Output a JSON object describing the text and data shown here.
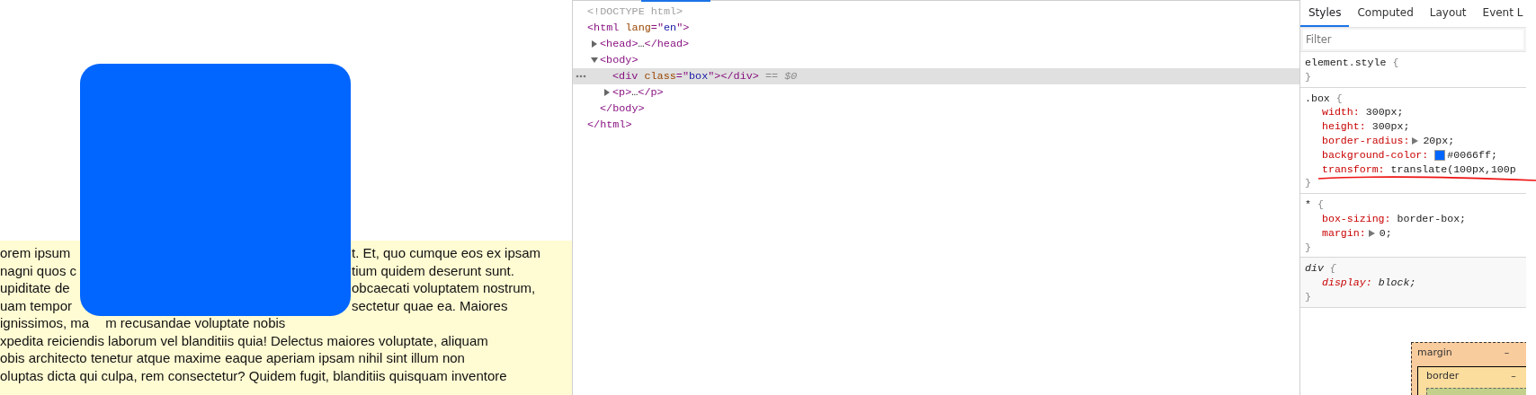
{
  "page": {
    "paragraph_lines": [
      {
        "left": "orem ipsum",
        "right": "t. Et, quo cumque eos ex ipsam"
      },
      {
        "left": "nagni quos c",
        "right": "tium quidem deserunt sunt."
      },
      {
        "left": "upiditate de",
        "right": "obcaecati voluptatem nostrum,"
      },
      {
        "left": "uam tempor",
        "right": "sectetur quae ea. Maiores"
      },
      {
        "left": "ignissimos, ma",
        "right": "m recusandae voluptate nobis"
      },
      {
        "text": "xpedita reiciendis laborum vel blanditiis quia! Delectus maiores voluptate, aliquam"
      },
      {
        "text": "obis architecto tenetur atque maxime eaque aperiam ipsam nihil sint illum non"
      },
      {
        "text": "oluptas dicta qui culpa, rem consectetur? Quidem fugit, blanditiis quisquam inventore"
      }
    ]
  },
  "elements": {
    "nodes": [
      {
        "selected": false,
        "tokens": [
          {
            "kind": "doctype",
            "text": "<!DOCTYPE html>"
          }
        ]
      },
      {
        "selected": false,
        "tokens": [
          {
            "kind": "tag",
            "text": "<html"
          },
          {
            "kind": "attr",
            "text": " lang"
          },
          {
            "kind": "tag",
            "text": "=\""
          },
          {
            "kind": "value",
            "text": "en"
          },
          {
            "kind": "tag",
            "text": "\">"
          }
        ],
        "children": [
          {
            "selected": false,
            "expanded": false,
            "tokens": [
              {
                "kind": "tag",
                "text": "<head>"
              },
              {
                "kind": "plain",
                "text": "…"
              },
              {
                "kind": "tag",
                "text": "</head>"
              }
            ]
          },
          {
            "selected": false,
            "expanded": true,
            "tokens": [
              {
                "kind": "tag",
                "text": "<body>"
              }
            ],
            "children": [
              {
                "selected": true,
                "tokens": [
                  {
                    "kind": "tag",
                    "text": "<div"
                  },
                  {
                    "kind": "attr",
                    "text": " class"
                  },
                  {
                    "kind": "tag",
                    "text": "=\""
                  },
                  {
                    "kind": "value",
                    "text": "box"
                  },
                  {
                    "kind": "tag",
                    "text": "\"></div>"
                  },
                  {
                    "kind": "ref",
                    "text": " == $0"
                  }
                ]
              },
              {
                "selected": false,
                "expanded": false,
                "tokens": [
                  {
                    "kind": "tag",
                    "text": "<p>"
                  },
                  {
                    "kind": "plain",
                    "text": "…"
                  },
                  {
                    "kind": "tag",
                    "text": "</p>"
                  }
                ]
              }
            ],
            "closing": [
              {
                "kind": "tag",
                "text": "</body>"
              }
            ]
          }
        ],
        "closing": [
          {
            "kind": "tag",
            "text": "</html>"
          }
        ]
      }
    ]
  },
  "styles": {
    "tabs": [
      {
        "label": "Styles",
        "selected": true
      },
      {
        "label": "Computed",
        "selected": false
      },
      {
        "label": "Layout",
        "selected": false
      },
      {
        "label": "Event L",
        "selected": false
      }
    ],
    "filter": {
      "placeholder": "Filter"
    },
    "rules": [
      {
        "kind": "inline",
        "selector": "element.style",
        "open": "{",
        "close": "}"
      },
      {
        "kind": "author",
        "selector": ".box",
        "open": "{",
        "close": "}",
        "props": [
          {
            "kind": "plain",
            "name": "width:",
            "value": "300px;"
          },
          {
            "kind": "plain",
            "name": "height:",
            "value": "300px;"
          },
          {
            "kind": "shorthand",
            "name": "border-radius:",
            "value": "20px;"
          },
          {
            "kind": "color",
            "name": "background-color:",
            "value": "#0066ff;"
          },
          {
            "kind": "plain",
            "name": "transform:",
            "value": "translate(100px,100p"
          }
        ]
      },
      {
        "kind": "author",
        "selector": "*",
        "open": "{",
        "close": "}",
        "props": [
          {
            "kind": "plain",
            "name": "box-sizing:",
            "value": "border-box;"
          },
          {
            "kind": "shorthand",
            "name": "margin:",
            "value": "0;"
          }
        ]
      },
      {
        "kind": "user_agent",
        "selector": "div",
        "open": "{",
        "close": "}",
        "props": [
          {
            "kind": "plain",
            "name": "display:",
            "value": "block;"
          }
        ]
      }
    ],
    "box_model": {
      "margin_label": "margin",
      "margin_value": "–",
      "border_label": "border",
      "border_value": "–"
    }
  }
}
